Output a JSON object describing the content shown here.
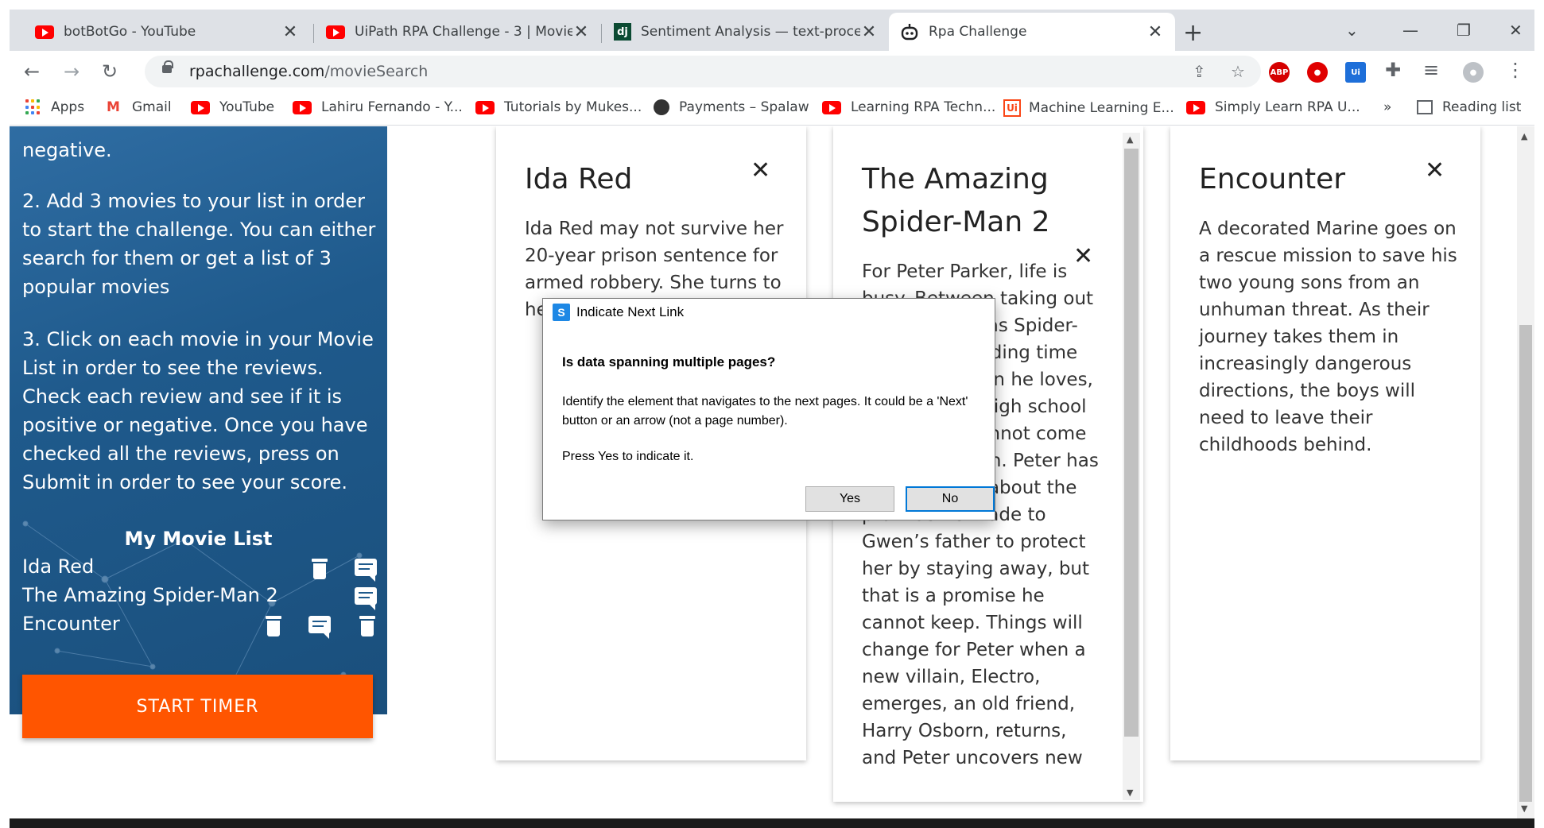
{
  "browser": {
    "tabs": [
      {
        "title": "botBotGo - YouTube",
        "icon": "youtube-icon"
      },
      {
        "title": "UiPath RPA Challenge - 3 | Movie",
        "icon": "youtube-icon"
      },
      {
        "title": "Sentiment Analysis — text-proce",
        "icon": "django-icon"
      },
      {
        "title": "Rpa Challenge",
        "icon": "robot-icon",
        "active": true
      }
    ],
    "new_tab": "+",
    "url_host": "rpachallenge.com",
    "url_path": "/movieSearch",
    "extensions": [
      "ABP"
    ],
    "bookmarks": [
      {
        "label": "Apps",
        "icon": "apps-grid-icon"
      },
      {
        "label": "Gmail",
        "icon": "gmail-icon"
      },
      {
        "label": "YouTube",
        "icon": "youtube-icon"
      },
      {
        "label": "Lahiru Fernando - Y...",
        "icon": "youtube-icon"
      },
      {
        "label": "Tutorials by Mukes...",
        "icon": "youtube-icon"
      },
      {
        "label": "Payments – Spalaw",
        "icon": "spalaw-icon"
      },
      {
        "label": "Learning RPA Techn...",
        "icon": "youtube-icon"
      },
      {
        "label": "Machine Learning E...",
        "icon": "uipath-icon"
      },
      {
        "label": "Simply Learn RPA U...",
        "icon": "youtube-icon"
      }
    ],
    "more_bookmarks": "»",
    "reading_list": "Reading list"
  },
  "sidebar": {
    "instructions": [
      "negative.",
      "2. Add 3 movies to your list in order to start the challenge. You can either search for them or get a list of 3 popular movies",
      "3. Click on each movie in your Movie List in order to see the reviews. Check each review and see if it is positive or negative. Once you have checked all the reviews, press on Submit in order to see your score."
    ],
    "my_movie_list_title": "My Movie List",
    "movies": [
      "Ida Red",
      "The Amazing Spider-Man 2",
      "Encounter"
    ],
    "start_button": "START TIMER"
  },
  "cards": [
    {
      "title": "Ida Red",
      "review": "Ida Red may not survive her 20-year prison sentence for armed robbery. She turns to he jo he"
    },
    {
      "title": "The Amazing Spider-Man 2",
      "review": "For Peter Parker, life is busy. Between taking out the bad guys as Spider-Man and spending time with the person he loves, Gwen Stacy, high school graduation cannot come quickly enough. Peter has not forgotten about the promise he made to Gwen’s father to protect her by staying away, but that is a promise he cannot keep. Things will change for Peter when a new villain, Electro, emerges, an old friend, Harry Osborn, returns, and Peter uncovers new"
    },
    {
      "title": "Encounter",
      "review": "A decorated Marine goes on a rescue mission to save his two young sons from an unhuman threat. As their journey takes them in increasingly dangerous directions, the boys will need to leave their childhoods behind."
    }
  ],
  "dialog": {
    "title": "Indicate Next Link",
    "question": "Is data spanning multiple pages?",
    "body": "Identify the element that navigates to the next pages. It could be a 'Next' button or an arrow (not a page number).",
    "press": "Press Yes to indicate it.",
    "yes": "Yes",
    "no": "No"
  },
  "colors": {
    "sidebar": "#1f5a8c",
    "start_button": "#ff5500",
    "youtube": "#ff0000"
  }
}
